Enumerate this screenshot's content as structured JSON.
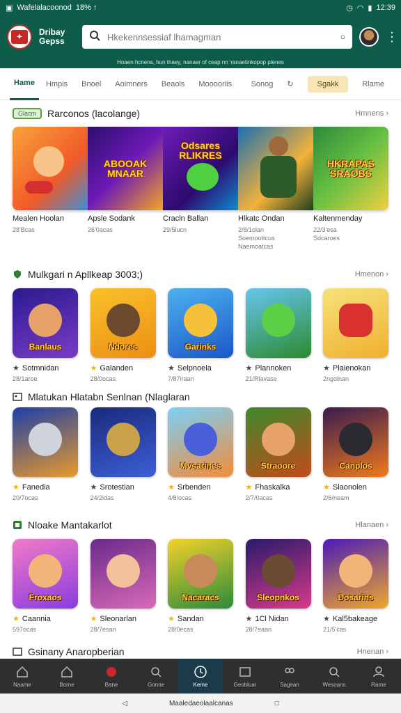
{
  "status": {
    "left_text": "Wafelalacoonod",
    "left_mid": "18% ↑",
    "time": "12:39"
  },
  "header": {
    "brand": "Dribay Gepss",
    "search_placeholder": "Hkekennsessiaf lhamagman"
  },
  "subheader": "Hoaen hcnens, hun thaey, nanaer of ceap nn 'ranaetinkopop plenes",
  "nav": {
    "tabs": [
      "Hame",
      "Hmpis",
      "Bnoel",
      "Aoimners",
      "Beaols",
      "Mooooriis"
    ],
    "extra": "Sonog",
    "signup": "Sgakk",
    "last": "Rlame"
  },
  "sections": {
    "s1": {
      "badge": "Glacm",
      "title": "Rarconos (lacolange)",
      "more": "Hmnens"
    },
    "s2": {
      "title": "Mulkgari n Apllkeap 3003;)",
      "more": "Hmenon"
    },
    "s3": {
      "title": "Mlatukan Hlatabn Senlnan (Nlaglaran",
      "more": ""
    },
    "s4": {
      "title": "Nloake Mantakarlot",
      "more": "Hlanaen"
    },
    "s5": {
      "title": "Gsinany Anaropberian",
      "more": "Hnenan"
    }
  },
  "banner": {
    "tiles": [
      "",
      "ABOOAK\nMNAAR",
      "Odsares\nRLIKRES",
      "",
      "HKRAPAS\nSRAOBS"
    ],
    "labels": [
      {
        "name": "Mealen Hoolan",
        "sub": "28'Bcas"
      },
      {
        "name": "Apsle Sodank",
        "sub": "26'0acas"
      },
      {
        "name": "Cracln Ballan",
        "sub": "29/5lucn"
      },
      {
        "name": "Hlkatc Ondan",
        "sub": "2/8/1olan\nSoemoottcus\nNaemoatcas"
      },
      {
        "name": "Kaltenmenday",
        "sub": "22/3'esa\nSdcaroes"
      }
    ]
  },
  "row2": [
    {
      "title": "Banlaus",
      "name": "Sotmnidan",
      "meta": "28/1aroe"
    },
    {
      "title": "Ndores",
      "name": "Galanden",
      "meta": "28/0ocas"
    },
    {
      "title": "Garinks",
      "name": "Selpnoela",
      "meta": "7/87iraan"
    },
    {
      "title": "",
      "name": "Plannoken",
      "meta": "21/Rlavase"
    },
    {
      "title": "",
      "name": "Plaienokan",
      "meta": "2ngolnan"
    }
  ],
  "row3": [
    {
      "title": "",
      "name": "Fanedia",
      "meta": "20/7ocas"
    },
    {
      "title": "",
      "name": "Srotestian",
      "meta": "24/2idas"
    },
    {
      "title": "Mvsarines",
      "name": "Srbenden",
      "meta": "4/8/ocas"
    },
    {
      "title": "Straoore",
      "name": "Fhaskalka",
      "meta": "2/7/0acas"
    },
    {
      "title": "Canplos",
      "name": "Slaonolen",
      "meta": "2/6/neam"
    }
  ],
  "row4": [
    {
      "title": "Froxaos",
      "name": "Caannia",
      "meta": "597ocas"
    },
    {
      "title": "",
      "name": "Sleonarlan",
      "meta": "28/7esan"
    },
    {
      "title": "Nacaracs",
      "name": "Sandan",
      "meta": "28/0ecas"
    },
    {
      "title": "Sleopnkos",
      "name": "1Cl Nidan",
      "meta": "28/7eaan"
    },
    {
      "title": "Dosarins",
      "name": "Kal5bakeage",
      "meta": "21/5'cas"
    }
  ],
  "bottom_nav": [
    "Naame",
    "Borne",
    "Bane",
    "Gonne",
    "Keme",
    "Geobluar",
    "Sagean",
    "Wesoans",
    "Rarne"
  ],
  "sysbar_center": "Maaledaeolaalcanas",
  "colors": {
    "brand": "#0e5d4b",
    "accent": "#f6e6b3",
    "star": "#f4b400"
  }
}
